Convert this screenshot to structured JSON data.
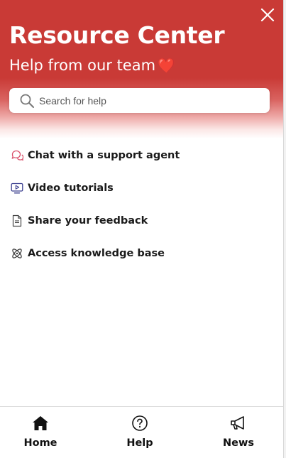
{
  "header": {
    "title": "Resource Center",
    "subtitle": "Help from our team",
    "heart": "❤️",
    "close_icon": "close-icon",
    "background_color": "#c93a36"
  },
  "search": {
    "placeholder": "Search for help",
    "value": "",
    "icon": "search-icon"
  },
  "menu": {
    "items": [
      {
        "label": "Chat with a support agent",
        "icon": "chat-bubbles-icon",
        "icon_color": "#d94f6a"
      },
      {
        "label": "Video tutorials",
        "icon": "video-icon",
        "icon_color": "#3b3f8f"
      },
      {
        "label": "Share your feedback",
        "icon": "document-icon",
        "icon_color": "#444444"
      },
      {
        "label": "Access knowledge base",
        "icon": "atom-icon",
        "icon_color": "#333333"
      }
    ]
  },
  "bottom_nav": {
    "items": [
      {
        "label": "Home",
        "icon": "home-icon"
      },
      {
        "label": "Help",
        "icon": "help-circle-icon"
      },
      {
        "label": "News",
        "icon": "megaphone-icon"
      }
    ]
  }
}
